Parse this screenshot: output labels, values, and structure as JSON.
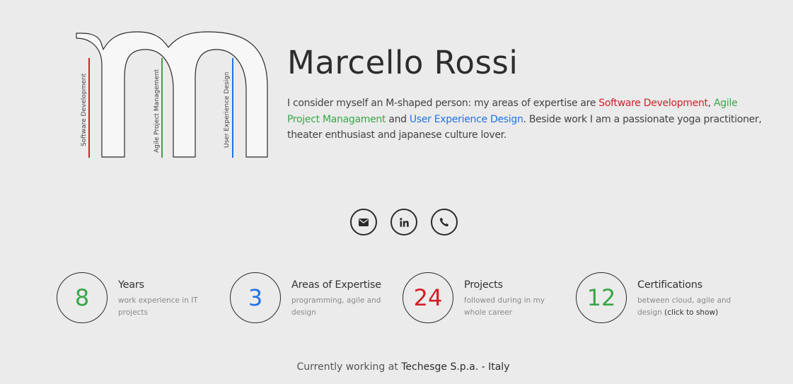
{
  "logo": {
    "labels": [
      "Software Development",
      "Agile Project Management",
      "User Experience Design"
    ],
    "colors": [
      "#d21f27",
      "#3aa64a",
      "#1e73e8"
    ]
  },
  "profile": {
    "name": "Marcello Rossi",
    "bio_intro": "I consider myself an M-shaped person: my areas of expertise are ",
    "area1": "Software Development",
    "sep1": ", ",
    "area2": "Agile Project Managament",
    "sep2": " and ",
    "area3": "User Experience Design",
    "bio_outro": ". Beside work I am a passionate yoga practitioner, theater enthusiast and japanese culture lover."
  },
  "contacts": {
    "icons": [
      "envelope-icon",
      "linkedin-icon",
      "phone-icon"
    ]
  },
  "stats": [
    {
      "value": "8",
      "color": "#3aa64a",
      "title": "Years",
      "desc": "work experience in IT projects"
    },
    {
      "value": "3",
      "color": "#1e73e8",
      "title": "Areas of Expertise",
      "desc": "programming, agile and design"
    },
    {
      "value": "24",
      "color": "#d21f27",
      "title": "Projects",
      "desc": "followed during in my whole career"
    },
    {
      "value": "12",
      "color": "#3aa64a",
      "title": "Certifications",
      "desc": "between cloud, agile and design ",
      "link": "(click to show)"
    }
  ],
  "footer": {
    "prefix": "Currently working at ",
    "company": "Techesge S.p.a. - Italy"
  }
}
